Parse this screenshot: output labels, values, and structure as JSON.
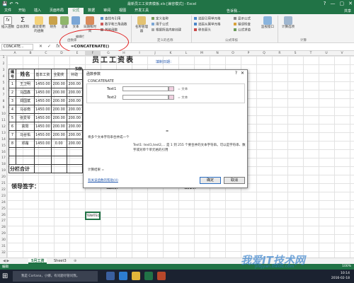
{
  "titlebar": {
    "title": "最新员工工资表模板.xls [兼容模式] - Excel",
    "qat": [
      "💾",
      "↶",
      "↷"
    ],
    "winbtns": [
      "?",
      "—",
      "▢",
      "✕"
    ]
  },
  "ribbon_tabs": [
    "文件",
    "开始",
    "插入",
    "页面布局",
    "公式",
    "数据",
    "审阅",
    "视图",
    "开发工具"
  ],
  "ribbon_tab_active": "公式",
  "tell_me": "告诉我...",
  "share": "共享",
  "ribbon": {
    "insert_fn": "插入函数",
    "autosum": "自动求和",
    "recent": "最近使用的函数",
    "financial": "财务",
    "logical": "逻辑",
    "text": "文本",
    "datetime": "日期和时间",
    "lookup": "查找与引用",
    "math": "数学和三角函数",
    "other": "其他函数",
    "group_library": "函数库",
    "name_mgr": "名称管理器",
    "define_name": "定义名称",
    "use_formula": "用于公式",
    "create_sel": "根据所选内容创建",
    "group_names": "定义的名称",
    "trace_prec": "追踪引用单元格",
    "trace_dep": "追踪从属单元格",
    "remove_arrows": "移去箭头",
    "show_formulas": "显示公式",
    "error_check": "错误检查",
    "eval_formula": "公式求值",
    "watch": "监视窗口",
    "group_audit": "公式审核",
    "calc_options": "计算选项",
    "group_calc": "计算"
  },
  "formula_bar": {
    "namebox": "CONCATE...",
    "icons": [
      "✕",
      "✓",
      "fx"
    ],
    "formula": "=CONCATENATE()",
    "tooltip": "编辑栏"
  },
  "columns": [
    "A",
    "B",
    "C",
    "D",
    "E",
    "F",
    "G",
    "H",
    "I",
    "J",
    "K",
    "L",
    "M",
    "N",
    "O",
    "P",
    "Q",
    "R",
    "S",
    "T",
    "U",
    "V"
  ],
  "rows": [
    "1",
    "2",
    "3",
    "4",
    "5",
    "6",
    "7",
    "8",
    "9",
    "10",
    "11",
    "12",
    "13",
    "14",
    "15",
    "16",
    "17",
    "18",
    "19",
    "20",
    "21",
    "22",
    "23",
    "24",
    "25",
    "26",
    "27",
    "28",
    "29",
    "30",
    "31",
    "32"
  ],
  "sheet": {
    "title": "员工工资表",
    "subtitle": "填制日期：",
    "col_header_right": "扣款",
    "header_no": "编号",
    "header_name": "姓名",
    "header_base": "基本工资",
    "header_allow": "全勤奖",
    "header_extra": "补助",
    "employees": [
      {
        "no": "1",
        "name": "王卫明",
        "base": "1450.00",
        "allow": "200.00",
        "extra": "200.00"
      },
      {
        "no": "2",
        "name": "马国鑫",
        "base": "1450.00",
        "allow": "200.00",
        "extra": "200.00"
      },
      {
        "no": "3",
        "name": "郑国斌",
        "base": "1450.00",
        "allow": "200.00",
        "extra": "200.00"
      },
      {
        "no": "4",
        "name": "马谷南",
        "base": "1450.00",
        "allow": "200.00",
        "extra": "200.00"
      },
      {
        "no": "5",
        "name": "张爱琴",
        "base": "1450.00",
        "allow": "200.00",
        "extra": "200.00"
      },
      {
        "no": "6",
        "name": "高阳",
        "base": "1450.00",
        "allow": "200.00",
        "extra": "200.00"
      },
      {
        "no": "7",
        "name": "马谷佑",
        "base": "1450.00",
        "allow": "200.00",
        "extra": "200.00"
      },
      {
        "no": "8",
        "name": "邓霜",
        "base": "1450.00",
        "allow": "0.00",
        "extra": "200.00"
      }
    ],
    "subtotal": "分栏合计",
    "leader_sign": "领导签字：",
    "cashier": "出纳：",
    "accountant": "制表：",
    "active_cell": "TENATE()"
  },
  "dialog": {
    "title": "函数参数",
    "help": "?",
    "close": "✕",
    "function_name": "CONCATENATE",
    "args": [
      {
        "label": "Text1",
        "result": "= 文本"
      },
      {
        "label": "Text2",
        "result": "= 文本"
      }
    ],
    "equals": "=",
    "description": "将多个文本字符串合并成一个",
    "detail": "Text1: text1,text2,... 是 1 到 255 个要合并的文本字符串。可以是字符串、数字或对单个单元格的引用",
    "result_label": "计算结果 =",
    "help_link": "有关该函数的帮助(H)",
    "ok": "确定",
    "cancel": "取消"
  },
  "sheet_tabs": {
    "nav": "◀ ▶",
    "tabs": [
      "5月工资",
      "Sheet3"
    ],
    "add": "⊕"
  },
  "statusbar": {
    "mode": "编辑",
    "zoom": "100%"
  },
  "taskbar": {
    "search_placeholder": "我是 Cortana，小娜。有问题尽管问我。",
    "time": "10:14",
    "date": "2016-02-18"
  },
  "watermark": {
    "text": "我爱IT技术网",
    "url": "jingyan.baidu.com"
  },
  "colors": {
    "excel_green": "#217346",
    "highlight_red": "#e02020",
    "dialog_link": "#2a5db0"
  }
}
